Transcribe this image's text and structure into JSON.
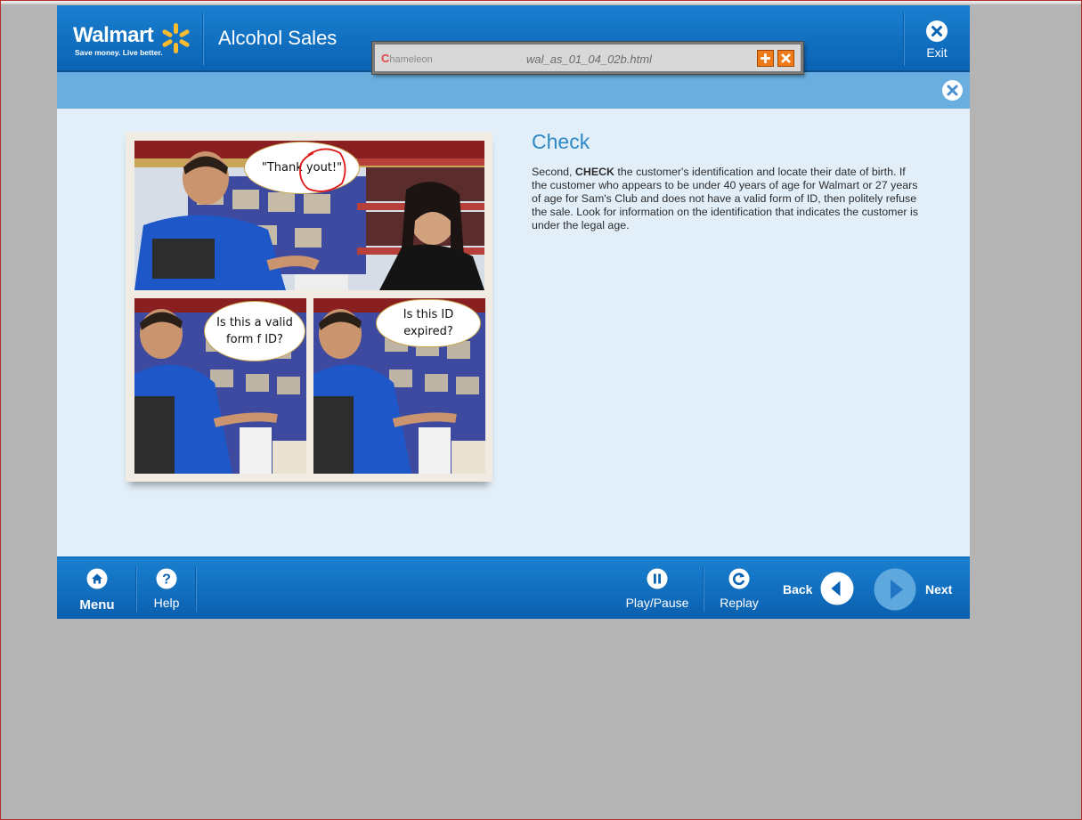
{
  "header": {
    "brand": "Walmart",
    "tagline": "Save money. Live better.",
    "course_title": "Alcohol Sales",
    "exit_label": "Exit"
  },
  "chameleon": {
    "logo_text": "hameleon",
    "logo_initial": "C",
    "file_name": "wal_as_01_04_02b.html"
  },
  "comic": {
    "bubble_top": "\"Thank yout!\"",
    "bubble_left": "Is this a valid form f ID?",
    "bubble_right": "Is this ID expired?"
  },
  "content": {
    "heading": "Check",
    "para_before": "Second, ",
    "para_bold": "CHECK",
    "para_after": " the customer's identification and locate their date of birth. If the customer who appears to be under 40 years of age for Walmart or 27 years of age for Sam's Club and does not have a valid form of ID, then politely refuse the sale.  Look for information on the identification that indicates the customer is under the legal age."
  },
  "footer": {
    "menu_label": "Menu",
    "help_label": "Help",
    "playpause_label": "Play/Pause",
    "replay_label": "Replay",
    "back_label": "Back",
    "next_label": "Next"
  },
  "colors": {
    "brand_blue": "#0a63b3",
    "subbar_blue": "#6aaedf",
    "content_bg": "#e2eff9",
    "heading_blue": "#2f88c6",
    "spark_yellow": "#fdbb30",
    "highlight_red": "#e01818"
  }
}
